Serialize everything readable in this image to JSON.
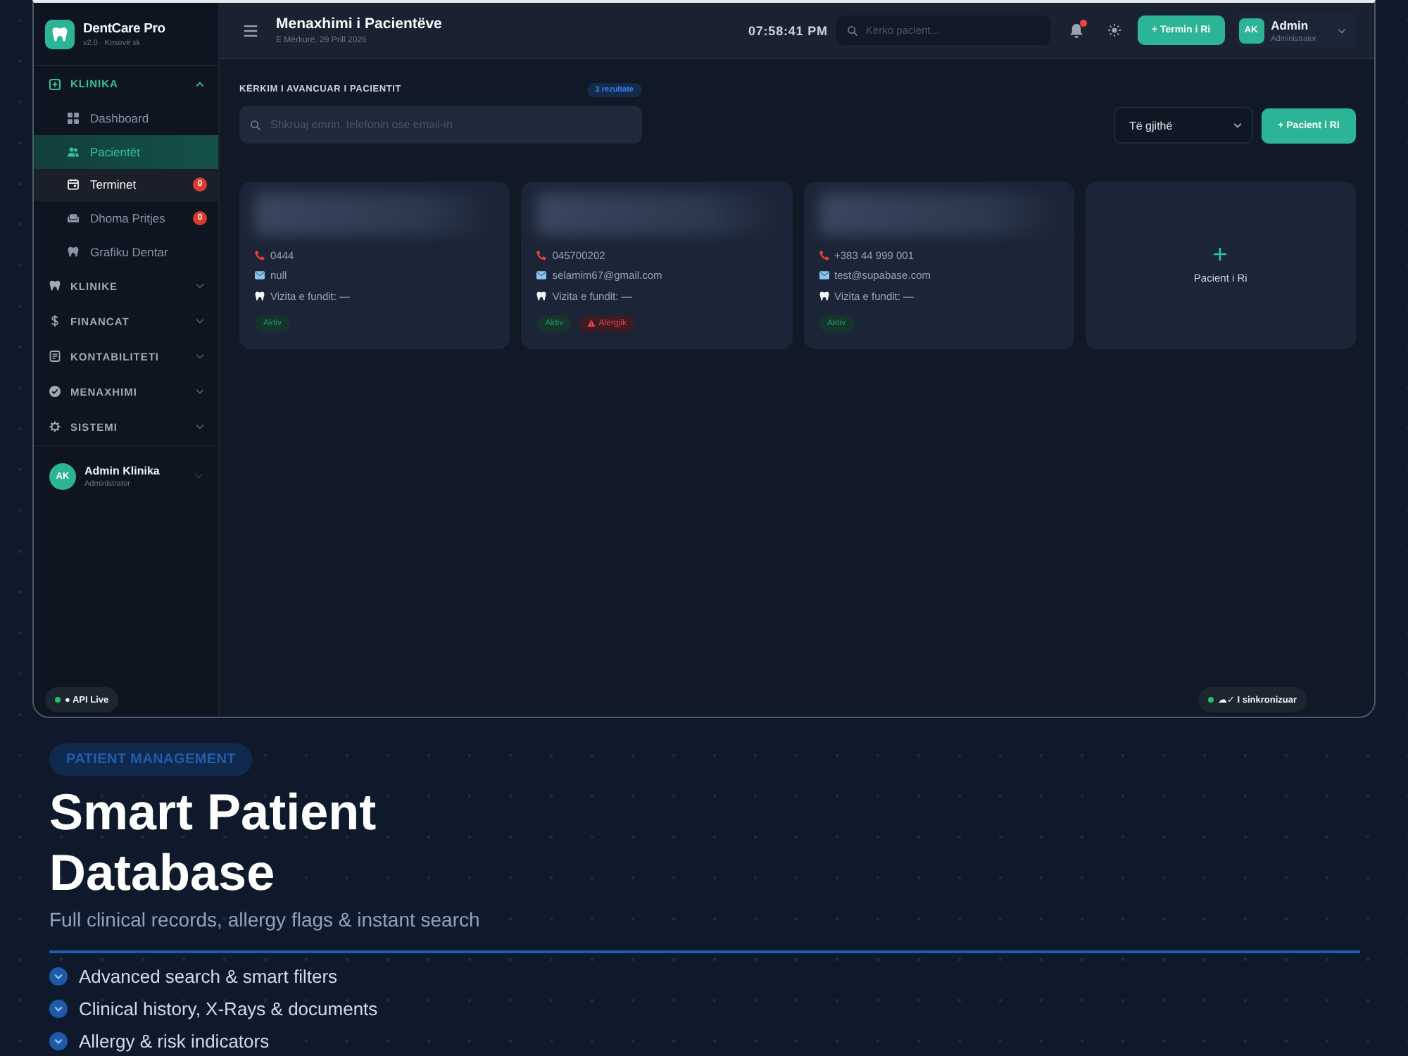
{
  "app": {
    "sidebar": {
      "brand": {
        "name": "DentCare Pro",
        "subtitle": "v2.0 · Kosovë xk"
      },
      "sections": [
        {
          "label": "KLINIKA",
          "expanded": true,
          "children": [
            {
              "label": "Dashboard",
              "selected": false,
              "hovered": false
            },
            {
              "label": "Pacientët",
              "selected": true,
              "hovered": false
            },
            {
              "label": "Terminet",
              "selected": false,
              "hovered": true,
              "badge": "0"
            },
            {
              "label": "Dhoma Pritjes",
              "selected": false,
              "hovered": false,
              "badge": "0"
            },
            {
              "label": "Grafiku Dentar",
              "selected": false,
              "hovered": false
            }
          ]
        },
        {
          "label": "KLINIKE",
          "expanded": false
        },
        {
          "label": "FINANCAT",
          "expanded": false
        },
        {
          "label": "KONTABILITETI",
          "expanded": false
        },
        {
          "label": "MENAXHIMI",
          "expanded": false
        },
        {
          "label": "SISTEMI",
          "expanded": false
        }
      ],
      "user": {
        "initials": "AK",
        "name": "Admin Klinika",
        "role": "Administrator"
      },
      "status_pill": "● API Live"
    },
    "header": {
      "title": "Menaxhimi i Pacientëve",
      "date": "E Mërkurë, 29 Prill 2026",
      "clock": "07:58:41 PM",
      "search": {
        "placeholder": "Kërko pacient..."
      },
      "notifications": {
        "unread": true
      },
      "new_appointment_button": "+ Termin i Ri",
      "user": {
        "initials": "AK",
        "name": "Admin",
        "role": "Administrator"
      }
    },
    "search_panel": {
      "heading": "KËRKIM I AVANCUAR I PACIENTIT",
      "result_badge": "3 rezultate",
      "search": {
        "placeholder": "Shkruaj emrin, telefonin ose email-in"
      },
      "filter": {
        "value": "Të gjithë"
      },
      "add_button": "+ Pacient i Ri"
    },
    "patients": [
      {
        "phone": "0444",
        "email": "null",
        "last_visit": "Vizita e fundit: —",
        "tags": [
          {
            "kind": "active",
            "label": "Aktiv"
          }
        ]
      },
      {
        "phone": "045700202",
        "email": "selamim67@gmail.com",
        "last_visit": "Vizita e fundit: —",
        "tags": [
          {
            "kind": "active",
            "label": "Aktiv"
          },
          {
            "kind": "allergy",
            "label": "Alergjik"
          }
        ]
      },
      {
        "phone": "+383 44 999 001",
        "email": "test@supabase.com",
        "last_visit": "Vizita e fundit: —",
        "tags": [
          {
            "kind": "active",
            "label": "Aktiv"
          }
        ]
      }
    ],
    "add_card": {
      "label": "Pacient i Ri"
    },
    "sync_pill": "☁✓ I sinkronizuar"
  },
  "feature": {
    "tag": "PATIENT MANAGEMENT",
    "title": "Smart Patient Database",
    "subtitle": "Full clinical records, allergy flags & instant search",
    "bullets": [
      "Advanced search & smart filters",
      "Clinical history, X-Rays & documents",
      "Allergy & risk indicators"
    ]
  }
}
